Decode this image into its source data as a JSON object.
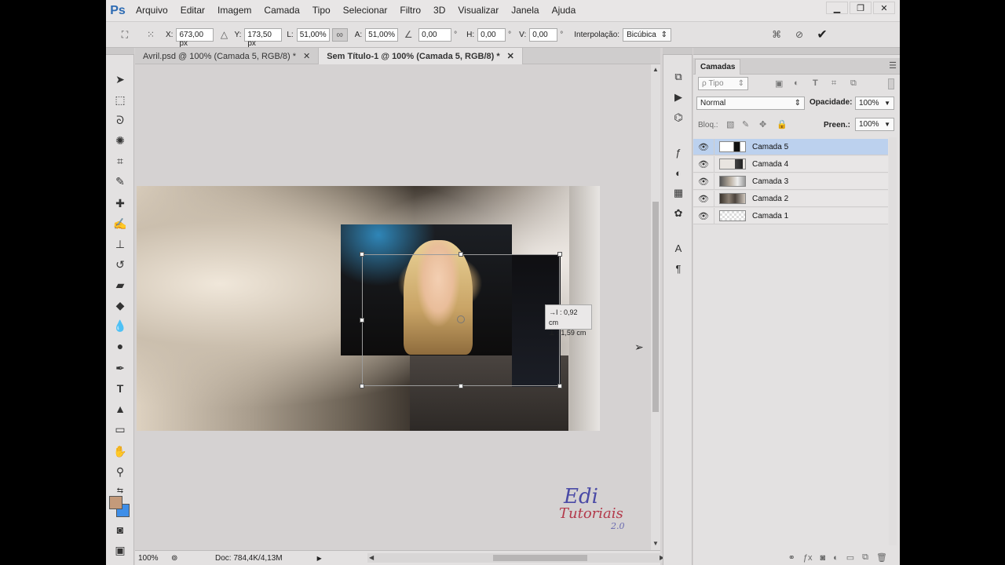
{
  "app": {
    "logo": "Ps"
  },
  "menu": [
    "Arquivo",
    "Editar",
    "Imagem",
    "Camada",
    "Tipo",
    "Selecionar",
    "Filtro",
    "3D",
    "Visualizar",
    "Janela",
    "Ajuda"
  ],
  "window_controls": [
    "minimize",
    "restore",
    "close"
  ],
  "options": {
    "x_label": "X:",
    "x_value": "673,00 px",
    "y_label": "Y:",
    "y_value": "173,50 px",
    "l_label": "L:",
    "l_value": "51,00%",
    "a_label": "A:",
    "a_value": "51,00%",
    "angle_value": "0,00",
    "angle_unit": "°",
    "h_label": "H:",
    "h_value": "0,00",
    "h_unit": "°",
    "v_label": "V:",
    "v_value": "0,00",
    "v_unit": "°",
    "interp_label": "Interpolação:",
    "interp_value": "Bicúbica"
  },
  "tabs": [
    {
      "label": "Avril.psd @ 100% (Camada 5, RGB/8) *",
      "active": false
    },
    {
      "label": "Sem Título-1 @ 100% (Camada 5, RGB/8) *",
      "active": true
    }
  ],
  "transform_info": {
    "dx": "→I :  0,92 cm",
    "dy": "⊥ :  1,59 cm"
  },
  "status": {
    "zoom": "100%",
    "doc": "Doc: 784,4K/4,13M"
  },
  "watermark": {
    "line1": "Edi",
    "line2": "Tutoriais",
    "line3": "2.0"
  },
  "layers_panel": {
    "title": "Camadas",
    "filter_placeholder": "ρ Tipo",
    "blend_mode": "Normal",
    "opacity_label": "Opacidade:",
    "opacity_value": "100%",
    "lock_label": "Bloq.:",
    "fill_label": "Preen.:",
    "fill_value": "100%",
    "layers": [
      {
        "name": "Camada 5",
        "selected": true
      },
      {
        "name": "Camada 4",
        "selected": false
      },
      {
        "name": "Camada 3",
        "selected": false
      },
      {
        "name": "Camada 2",
        "selected": false
      },
      {
        "name": "Camada 1",
        "selected": false
      }
    ]
  },
  "colors": {
    "foreground": "#c49a7a",
    "background": "#3e8ee8",
    "selection": "#bcd1ee"
  }
}
